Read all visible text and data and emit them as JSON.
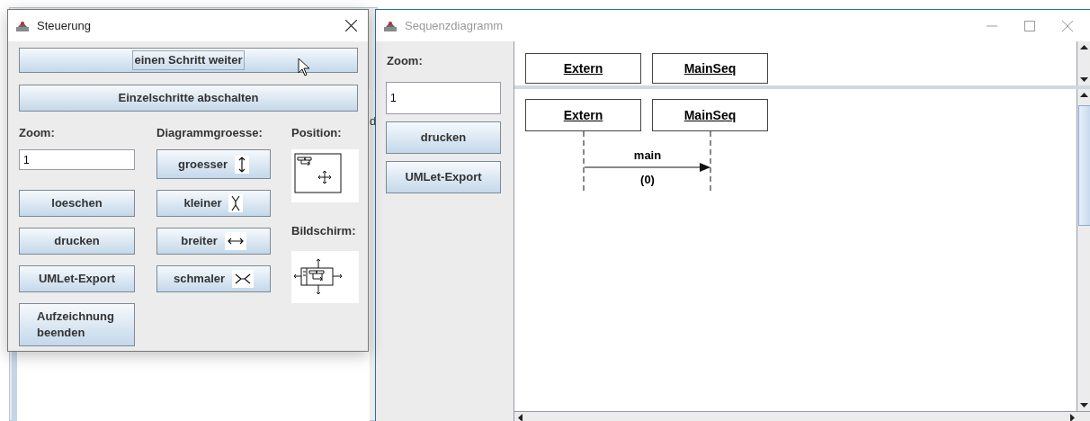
{
  "background_window": {
    "visible_text": "d"
  },
  "control_window": {
    "title": "Steuerung",
    "wide_buttons": [
      {
        "label": "einen Schritt weiter",
        "focused": true
      },
      {
        "label": "Einzelschritte abschalten",
        "focused": false
      }
    ],
    "zoom_label": "Zoom:",
    "zoom_value": "1",
    "left_buttons": [
      "loeschen",
      "drucken",
      "UMLet-Export",
      "Aufzeichnung beenden"
    ],
    "size_label": "Diagrammgroesse:",
    "size_buttons": [
      {
        "label": "groesser",
        "kind": "taller"
      },
      {
        "label": "kleiner",
        "kind": "shorter"
      },
      {
        "label": "breiter",
        "kind": "wider"
      },
      {
        "label": "schmaler",
        "kind": "narrower"
      }
    ],
    "position_label": "Position:",
    "screen_label": "Bildschirm:"
  },
  "diagram_window": {
    "title": "Sequenzdiagramm",
    "zoom_label": "Zoom:",
    "zoom_value": "1",
    "buttons": [
      "drucken",
      "UMLet-Export"
    ],
    "header_objects": [
      "Extern",
      "MainSeq"
    ],
    "objects": [
      "Extern",
      "MainSeq"
    ],
    "messages": [
      {
        "label": "main",
        "arguments": "(0)"
      }
    ]
  }
}
